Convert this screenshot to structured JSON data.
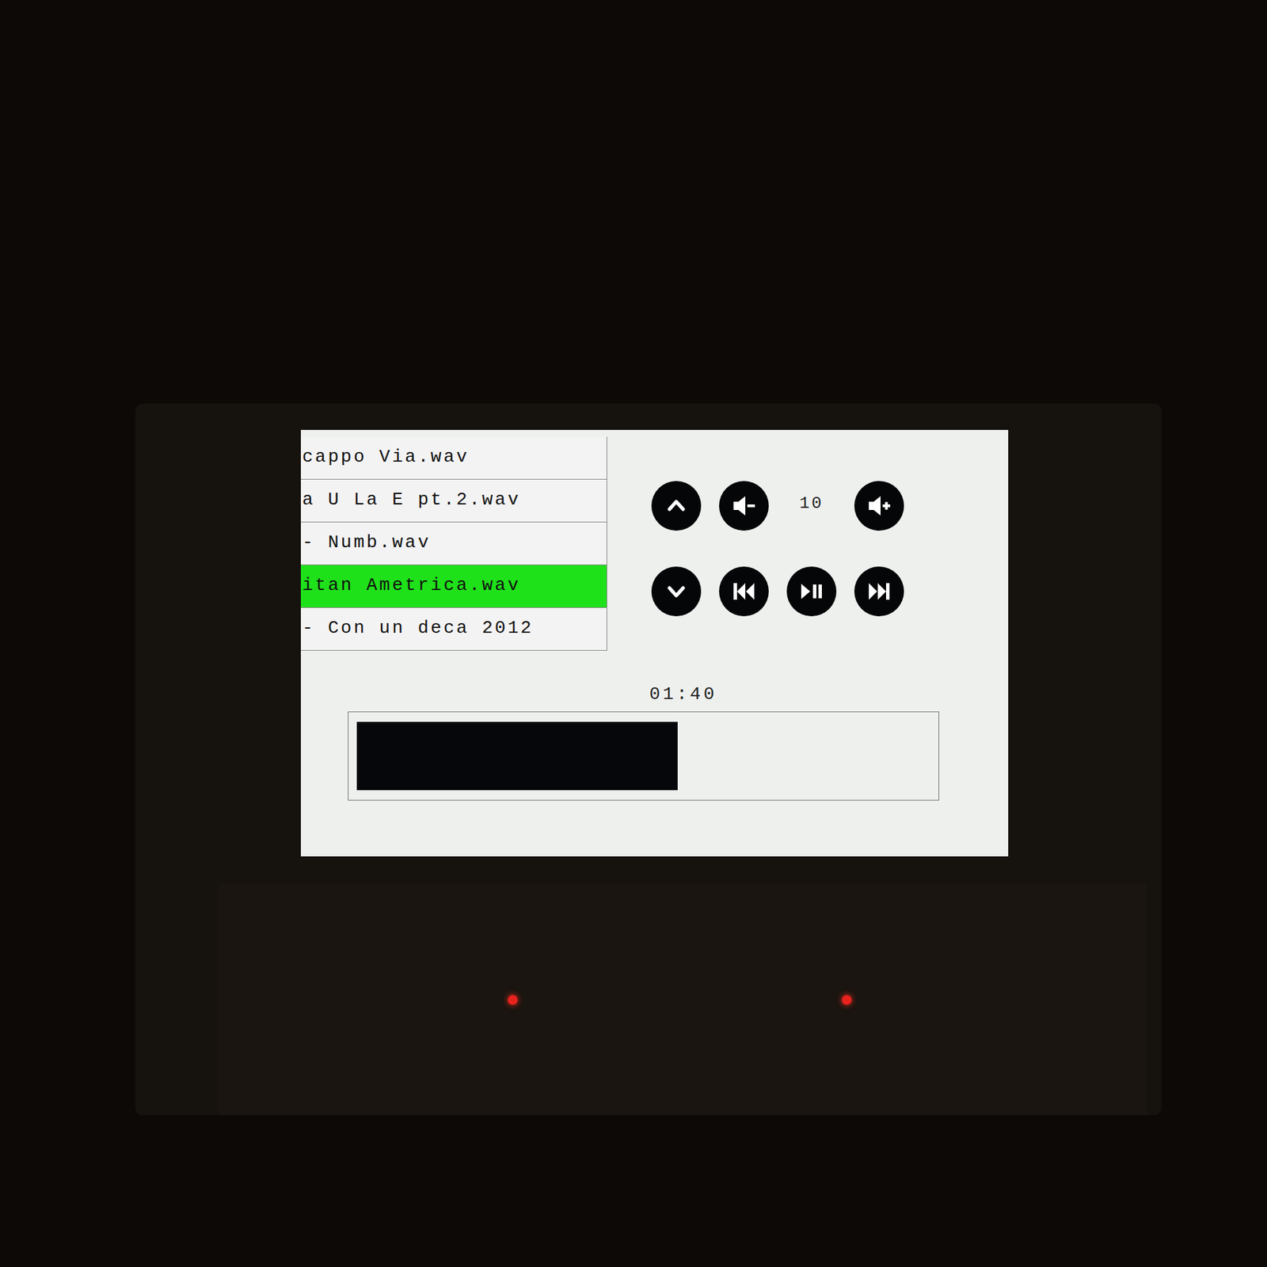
{
  "playlist": [
    {
      "title": "cappo Via.wav",
      "selected": false
    },
    {
      "title": "a U La E pt.2.wav",
      "selected": false
    },
    {
      "title": "- Numb.wav",
      "selected": false
    },
    {
      "title": "itan Ametrica.wav",
      "selected": true
    },
    {
      "title": "- Con un deca 2012",
      "selected": false
    }
  ],
  "volume": "10",
  "time": "01:40",
  "progress": {
    "level": 0.56
  }
}
